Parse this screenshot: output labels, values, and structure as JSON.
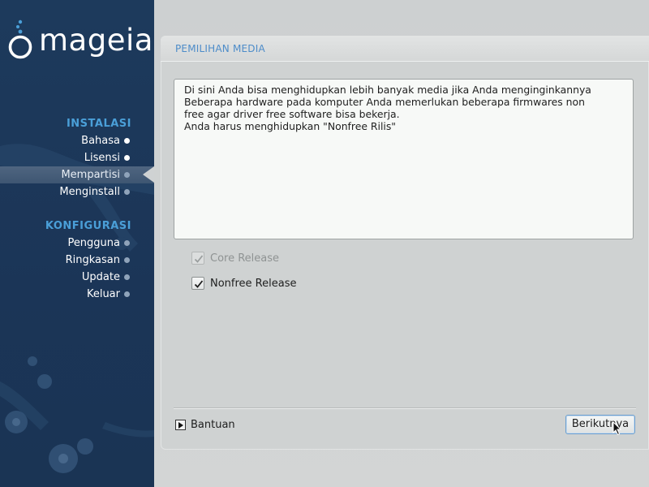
{
  "brand": {
    "logo_text": "mageia"
  },
  "sidebar": {
    "sections": [
      {
        "title": "INSTALASI",
        "items": [
          {
            "label": "Bahasa",
            "state": "done"
          },
          {
            "label": "Lisensi",
            "state": "done"
          },
          {
            "label": "Mempartisi",
            "state": "active"
          },
          {
            "label": "Menginstall",
            "state": "future"
          }
        ]
      },
      {
        "title": "KONFIGURASI",
        "items": [
          {
            "label": "Pengguna",
            "state": "future"
          },
          {
            "label": "Ringkasan",
            "state": "future"
          },
          {
            "label": "Update",
            "state": "future"
          },
          {
            "label": "Keluar",
            "state": "future"
          }
        ]
      }
    ]
  },
  "panel": {
    "title": "PEMILIHAN MEDIA",
    "info_lines": [
      "Di sini Anda bisa menghidupkan lebih banyak media jika Anda menginginkannya",
      "Beberapa hardware pada komputer Anda memerlukan beberapa firmwares non",
      "free agar driver free software bisa bekerja.",
      "Anda harus menghidupkan \"Nonfree Rilis\""
    ],
    "checkboxes": [
      {
        "label": "Core Release",
        "checked": true,
        "enabled": false
      },
      {
        "label": "Nonfree Release",
        "checked": true,
        "enabled": true
      }
    ],
    "help_label": "Bantuan",
    "next_label": "Berikutnya"
  },
  "colors": {
    "sidebar_bg": "#1d3a5c",
    "section_title": "#4a9fd8",
    "panel_title": "#4d8cc9",
    "panel_bg": "#cfd2d2"
  }
}
